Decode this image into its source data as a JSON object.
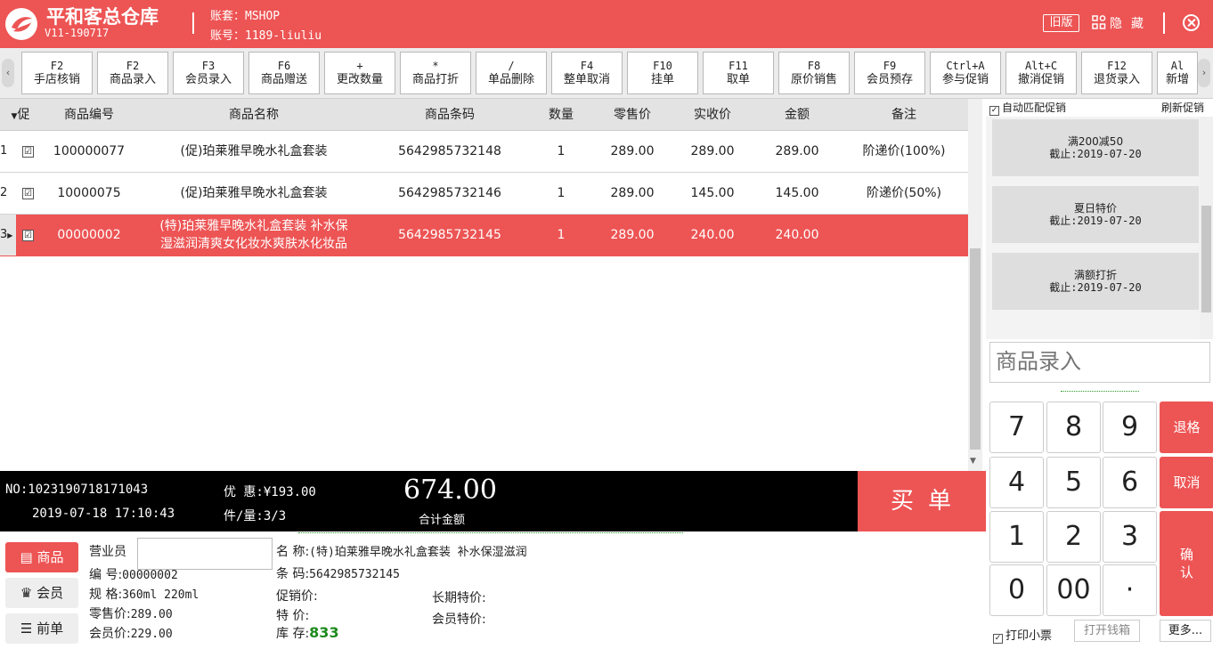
{
  "titlebar": {
    "app_name": "平和客总仓库",
    "version": "V11-190717",
    "account_set": "账套：MSHOP",
    "account_no": "账号：1189-liuliu",
    "old_version": "旧版",
    "hide": "隐藏"
  },
  "toolbar": {
    "buttons": [
      {
        "key": "F2",
        "label": "手店核销"
      },
      {
        "key": "F2",
        "label": "商品录入"
      },
      {
        "key": "F3",
        "label": "会员录入"
      },
      {
        "key": "F6",
        "label": "商品赠送"
      },
      {
        "key": "+",
        "label": "更改数量"
      },
      {
        "key": "*",
        "label": "商品打折"
      },
      {
        "key": "/",
        "label": "单品删除"
      },
      {
        "key": "F4",
        "label": "整单取消"
      },
      {
        "key": "F10",
        "label": "挂单"
      },
      {
        "key": "F11",
        "label": "取单"
      },
      {
        "key": "F8",
        "label": "原价销售"
      },
      {
        "key": "F9",
        "label": "会员预存"
      },
      {
        "key": "Ctrl+A",
        "label": "参与促销"
      },
      {
        "key": "Alt+C",
        "label": "撤消促销"
      },
      {
        "key": "F12",
        "label": "退货录入"
      },
      {
        "key": "Al",
        "label": "新增"
      }
    ]
  },
  "table": {
    "headers": [
      "促",
      "商品编号",
      "商品名称",
      "商品条码",
      "数量",
      "零售价",
      "实收价",
      "金额",
      "备注"
    ],
    "rows": [
      {
        "n": "1",
        "check": "☑",
        "code": "100000077",
        "name": "(促)珀莱雅早晚水礼盒套装",
        "name2": "",
        "barcode": "5642985732148",
        "qty": "1",
        "retail": "289.00",
        "actual": "289.00",
        "amount": "289.00",
        "note": "阶递价(100%)"
      },
      {
        "n": "2",
        "check": "☑",
        "code": "10000075",
        "name": "(促)珀莱雅早晚水礼盒套装",
        "name2": "",
        "barcode": "5642985732146",
        "qty": "1",
        "retail": "289.00",
        "actual": "145.00",
        "amount": "145.00",
        "note": "阶递价(50%)"
      },
      {
        "n": "3",
        "check": "☑",
        "code": "00000002",
        "name": "(特)珀莱雅早晚水礼盒套装 补水保",
        "name2": "湿滋润清爽女化妆水爽肤水化妆品",
        "barcode": "5642985732145",
        "qty": "1",
        "retail": "289.00",
        "actual": "240.00",
        "amount": "240.00",
        "note": ""
      }
    ]
  },
  "info": {
    "order_no": "NO:1023190718171043",
    "order_time": "2019-07-18  17:10:43",
    "discount": "优 惠:¥193.00",
    "count": "件/量:3/3",
    "total": "674.00",
    "total_label": "合计金额",
    "checkout": "买单"
  },
  "detail": {
    "tabs": [
      "商品",
      "会员",
      "前单"
    ],
    "tab_icons": [
      "goods-icon",
      "crown-icon",
      "list-icon"
    ],
    "clerk_label": "营业员",
    "code_label": "编  号:",
    "code_value": "00000002",
    "spec_label": "规  格:",
    "spec_value": "360ml 220ml",
    "retail_label": "零售价:",
    "retail_value": "289.00",
    "member_label": "会员价:",
    "member_value": "229.00",
    "name_label": "名  称:",
    "name_value": "(特)珀莱雅早晚水礼盒套装 补水保湿滋润",
    "barcode_label": "条  码:",
    "barcode_value": "5642985732145",
    "promo_label": "促销价:",
    "special_label": "特  价:",
    "stock_label": "库  存:",
    "stock_value": "833",
    "long_special_label": "长期特价:",
    "member_special_label": "会员特价:"
  },
  "right": {
    "auto_promo": "自动匹配促销",
    "refresh_promo": "刷新促销",
    "promos": [
      {
        "title": "满200减50",
        "date": "截止:2019-07-20"
      },
      {
        "title": "夏日特价",
        "date": "截止:2019-07-20"
      },
      {
        "title": "满额打折",
        "date": "截止:2019-07-20"
      }
    ],
    "goods_entry_placeholder": "商品录入",
    "keys": [
      "7",
      "8",
      "9",
      "4",
      "5",
      "6",
      "1",
      "2",
      "3",
      "0",
      "00",
      "·"
    ],
    "backspace": "退格",
    "cancel": "取消",
    "confirm": "确认",
    "print_receipt": "打印小票",
    "open_drawer": "打开钱箱",
    "more": "更多..."
  },
  "colors": {
    "accent": "#ed5454",
    "stock": "#1e8a1e"
  }
}
